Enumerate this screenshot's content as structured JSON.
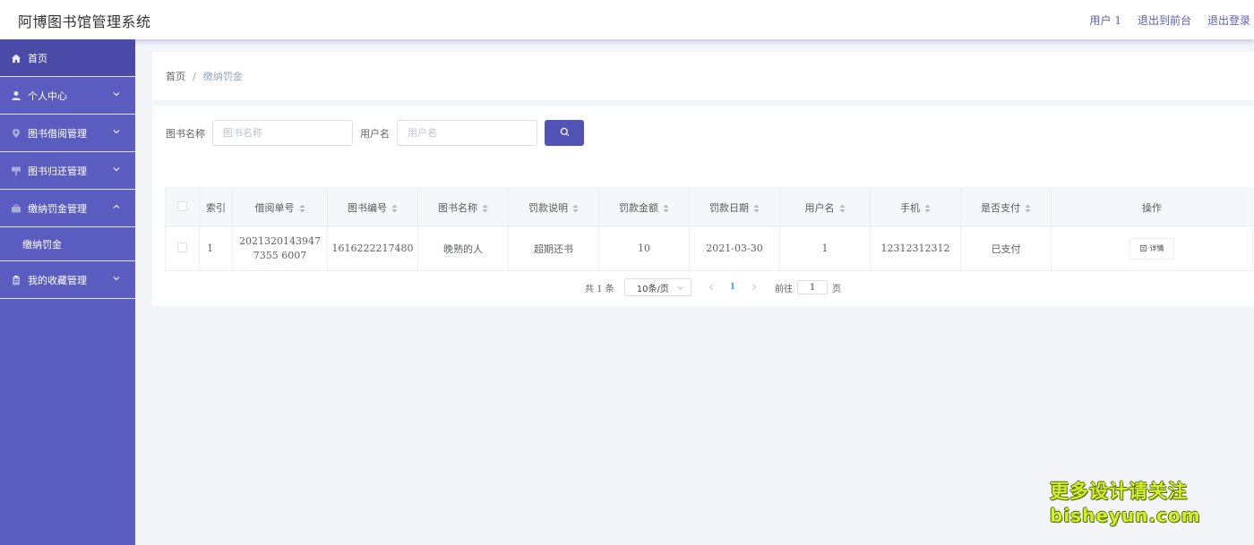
{
  "app": {
    "title": "阿博图书馆管理系统",
    "top_links": [
      "用户 1",
      "退出到前台",
      "退出登录"
    ]
  },
  "sidebar": {
    "items": [
      {
        "label": "首页",
        "icon": "home-icon",
        "active": true
      },
      {
        "label": "个人中心",
        "icon": "user-icon",
        "expand": "down"
      },
      {
        "label": "图书借阅管理",
        "icon": "pin-icon",
        "expand": "down"
      },
      {
        "label": "图书归还管理",
        "icon": "sign-icon",
        "expand": "down"
      },
      {
        "label": "缴纳罚金管理",
        "icon": "briefcase-icon",
        "expand": "up"
      },
      {
        "label": "我的收藏管理",
        "icon": "clipboard-icon",
        "expand": "down"
      }
    ],
    "subitems": {
      "fines": "缴纳罚金"
    }
  },
  "breadcrumb": {
    "home": "首页",
    "separator": "/",
    "current": "缴纳罚金"
  },
  "search": {
    "book_label": "图书名称",
    "book_placeholder": "图书名称",
    "user_label": "用户名",
    "user_placeholder": "用户名",
    "button_icon": "search-icon"
  },
  "table": {
    "headers": [
      "索引",
      "借阅单号",
      "图书编号",
      "图书名称",
      "罚款说明",
      "罚款金额",
      "罚款日期",
      "用户名",
      "手机",
      "是否支付",
      "操作"
    ],
    "rows": [
      {
        "index": "1",
        "borrow_no": "20213201439477355 6007",
        "book_no": "1616222217480",
        "book_name": "晚熟的人",
        "reason": "超期还书",
        "amount": "10",
        "date": "2021-03-30",
        "username": "1",
        "phone": "12312312312",
        "paid": "已支付",
        "action": "详情"
      }
    ]
  },
  "pagination": {
    "total": "共 1 条",
    "page_size": "10条/页",
    "current_page": "1",
    "goto_label": "前往",
    "goto_value": "1",
    "page_unit": "页"
  },
  "watermark": {
    "line1": "更多设计请关注",
    "line2": "bisheyun.com"
  },
  "colors": {
    "accent": "#5b5cc0",
    "sidebar_active": "#4a4ba8",
    "button": "#5153b5",
    "link": "#5a5fb9"
  }
}
